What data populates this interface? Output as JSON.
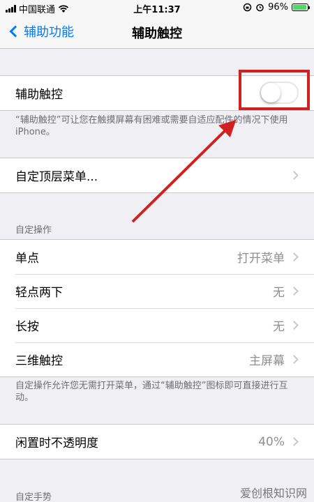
{
  "status_bar": {
    "carrier": "中国联通",
    "time": "上午11:37",
    "battery": "96%",
    "battery_level": 0.96
  },
  "nav": {
    "back_label": "辅助功能",
    "title": "辅助触控"
  },
  "assistive_touch": {
    "label": "辅助触控",
    "enabled": false,
    "description": "“辅助触控”可让您在触摸屏幕有困难或需要自适应配件的情况下使用 iPhone。"
  },
  "customize_menu": {
    "label": "自定顶层菜单..."
  },
  "custom_actions": {
    "header": "自定操作",
    "items": [
      {
        "label": "单点",
        "value": "打开菜单"
      },
      {
        "label": "轻点两下",
        "value": "无"
      },
      {
        "label": "长按",
        "value": "无"
      },
      {
        "label": "三维触控",
        "value": "主屏幕"
      }
    ],
    "footer": "自定操作允许您无需打开菜单，通过“辅助触控”图标即可直接进行互动。"
  },
  "idle_opacity": {
    "label": "闲置时不透明度",
    "value": "40%"
  },
  "custom_gestures": {
    "header": "自定手势"
  },
  "watermark": "爱创根知识网",
  "annotation_color": "#d0201f",
  "accent_color": "#007aff"
}
